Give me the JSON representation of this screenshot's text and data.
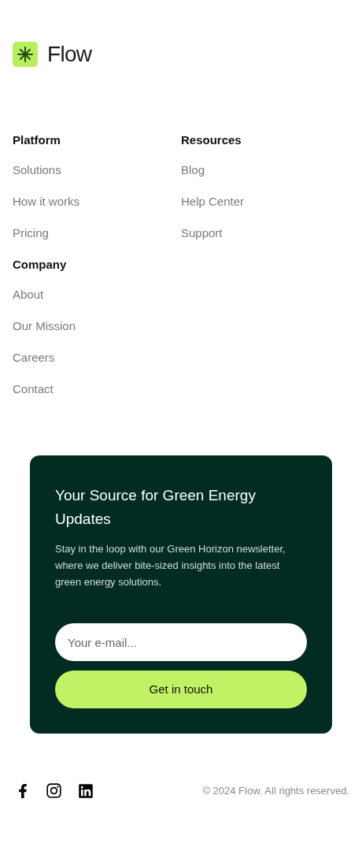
{
  "brand": {
    "name": "Flow"
  },
  "link_groups": [
    {
      "title": "Platform",
      "links": [
        "Solutions",
        "How it works",
        "Pricing"
      ]
    },
    {
      "title": "Resources",
      "links": [
        "Blog",
        "Help Center",
        "Support"
      ]
    },
    {
      "title": "Company",
      "links": [
        "About",
        "Our Mission",
        "Careers",
        "Contact"
      ]
    }
  ],
  "newsletter": {
    "title": "Your Source for Green Energy Updates",
    "text": "Stay in the loop with our Green Horizon newsletter, where we deliver bite-sized insights into the latest green energy solutions.",
    "email": {
      "placeholder": "Your e-mail..."
    },
    "button": "Get in touch"
  },
  "footer": {
    "copyright": "© 2024 Flow. All rights reserved."
  }
}
